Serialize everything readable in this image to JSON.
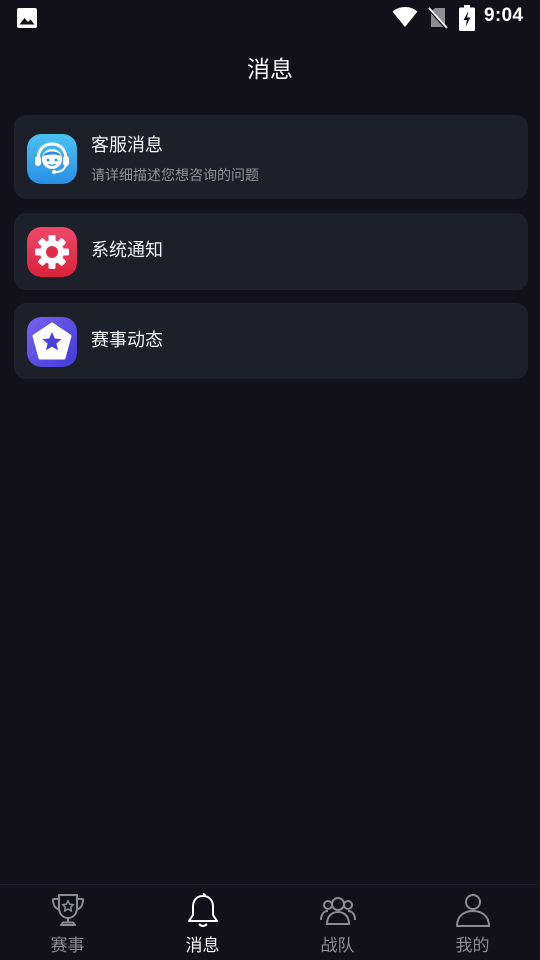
{
  "status_bar": {
    "time": "9:04",
    "icons": [
      "gallery-icon",
      "wifi-icon",
      "no-sim-icon",
      "battery-charging-icon"
    ]
  },
  "header": {
    "title": "消息"
  },
  "messages": [
    {
      "title": "客服消息",
      "subtitle": "请详细描述您想咨询的问题",
      "icon": "customer-service-icon",
      "icon_color": "#3aa8ee"
    },
    {
      "title": "系统通知",
      "icon": "gear-icon",
      "icon_color": "#e8324f"
    },
    {
      "title": "赛事动态",
      "icon": "star-icon",
      "icon_color": "#5a4fe6"
    }
  ],
  "bottom_nav": {
    "active": "消息",
    "items": [
      {
        "label": "赛事",
        "icon": "trophy-icon"
      },
      {
        "label": "消息",
        "icon": "bell-icon"
      },
      {
        "label": "战队",
        "icon": "team-icon"
      },
      {
        "label": "我的",
        "icon": "person-icon"
      }
    ]
  },
  "colors": {
    "background": "#121019",
    "card": "#1d2029",
    "inactive_text": "#8a8b93"
  }
}
